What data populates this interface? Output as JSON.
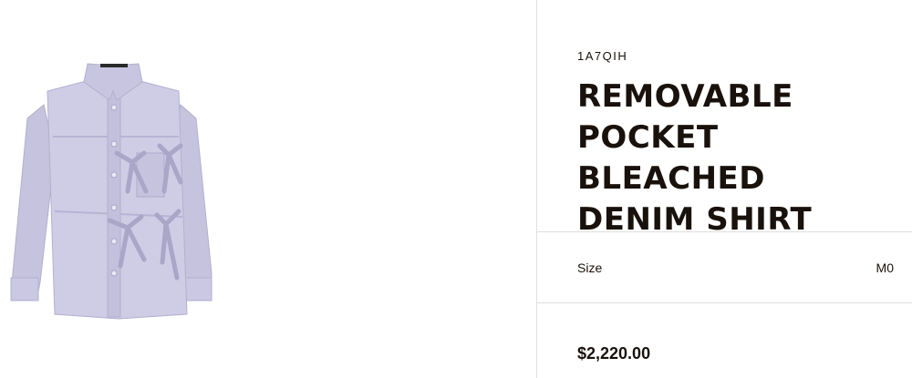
{
  "product": {
    "sku": "1A7QIH",
    "title": "REMOVABLE\nPOCKET BLEACHED\nDENIM SHIRT",
    "size_label": "Size",
    "size_value": "M0",
    "price": "$2,220.00",
    "image_icon": "denim-shirt-image"
  },
  "colors": {
    "text": "#19110b",
    "shirt": "#c9c6e2",
    "divider": "#e1dfdd"
  }
}
